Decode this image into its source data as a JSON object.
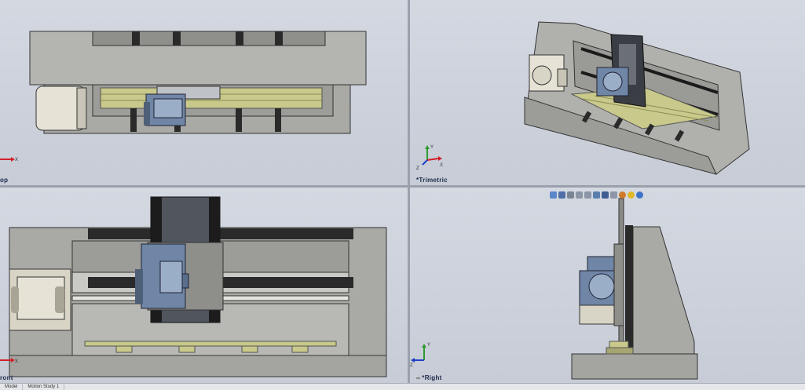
{
  "viewports": {
    "top": {
      "label": "op"
    },
    "trimetric": {
      "label": "*Trimetric"
    },
    "front": {
      "label": "ront"
    },
    "right": {
      "label": "*Right"
    }
  },
  "triad_axes": {
    "x": "X",
    "y": "Y",
    "z": "Z"
  },
  "colors": {
    "frame": "#a9a9a5",
    "rail": "#2a2a2a",
    "table": "#c8c98a",
    "head": "#6f86a6",
    "motor": "#e6e2d6",
    "axis_x": "#d4202a",
    "axis_y": "#2f9a2f",
    "axis_z": "#2140c8"
  },
  "toolbar": {
    "icons": [
      "view-orientation-icon",
      "zoom-fit-icon",
      "rotate-icon",
      "zoom-area-icon",
      "zoom-in-out-icon",
      "section-view-icon",
      "display-style-icon",
      "hide-show-icon",
      "edit-appearance-icon",
      "apply-scene-icon",
      "view-settings-icon"
    ]
  },
  "statusbar": {
    "tabs": [
      "Model",
      "Motion Study 1"
    ]
  }
}
